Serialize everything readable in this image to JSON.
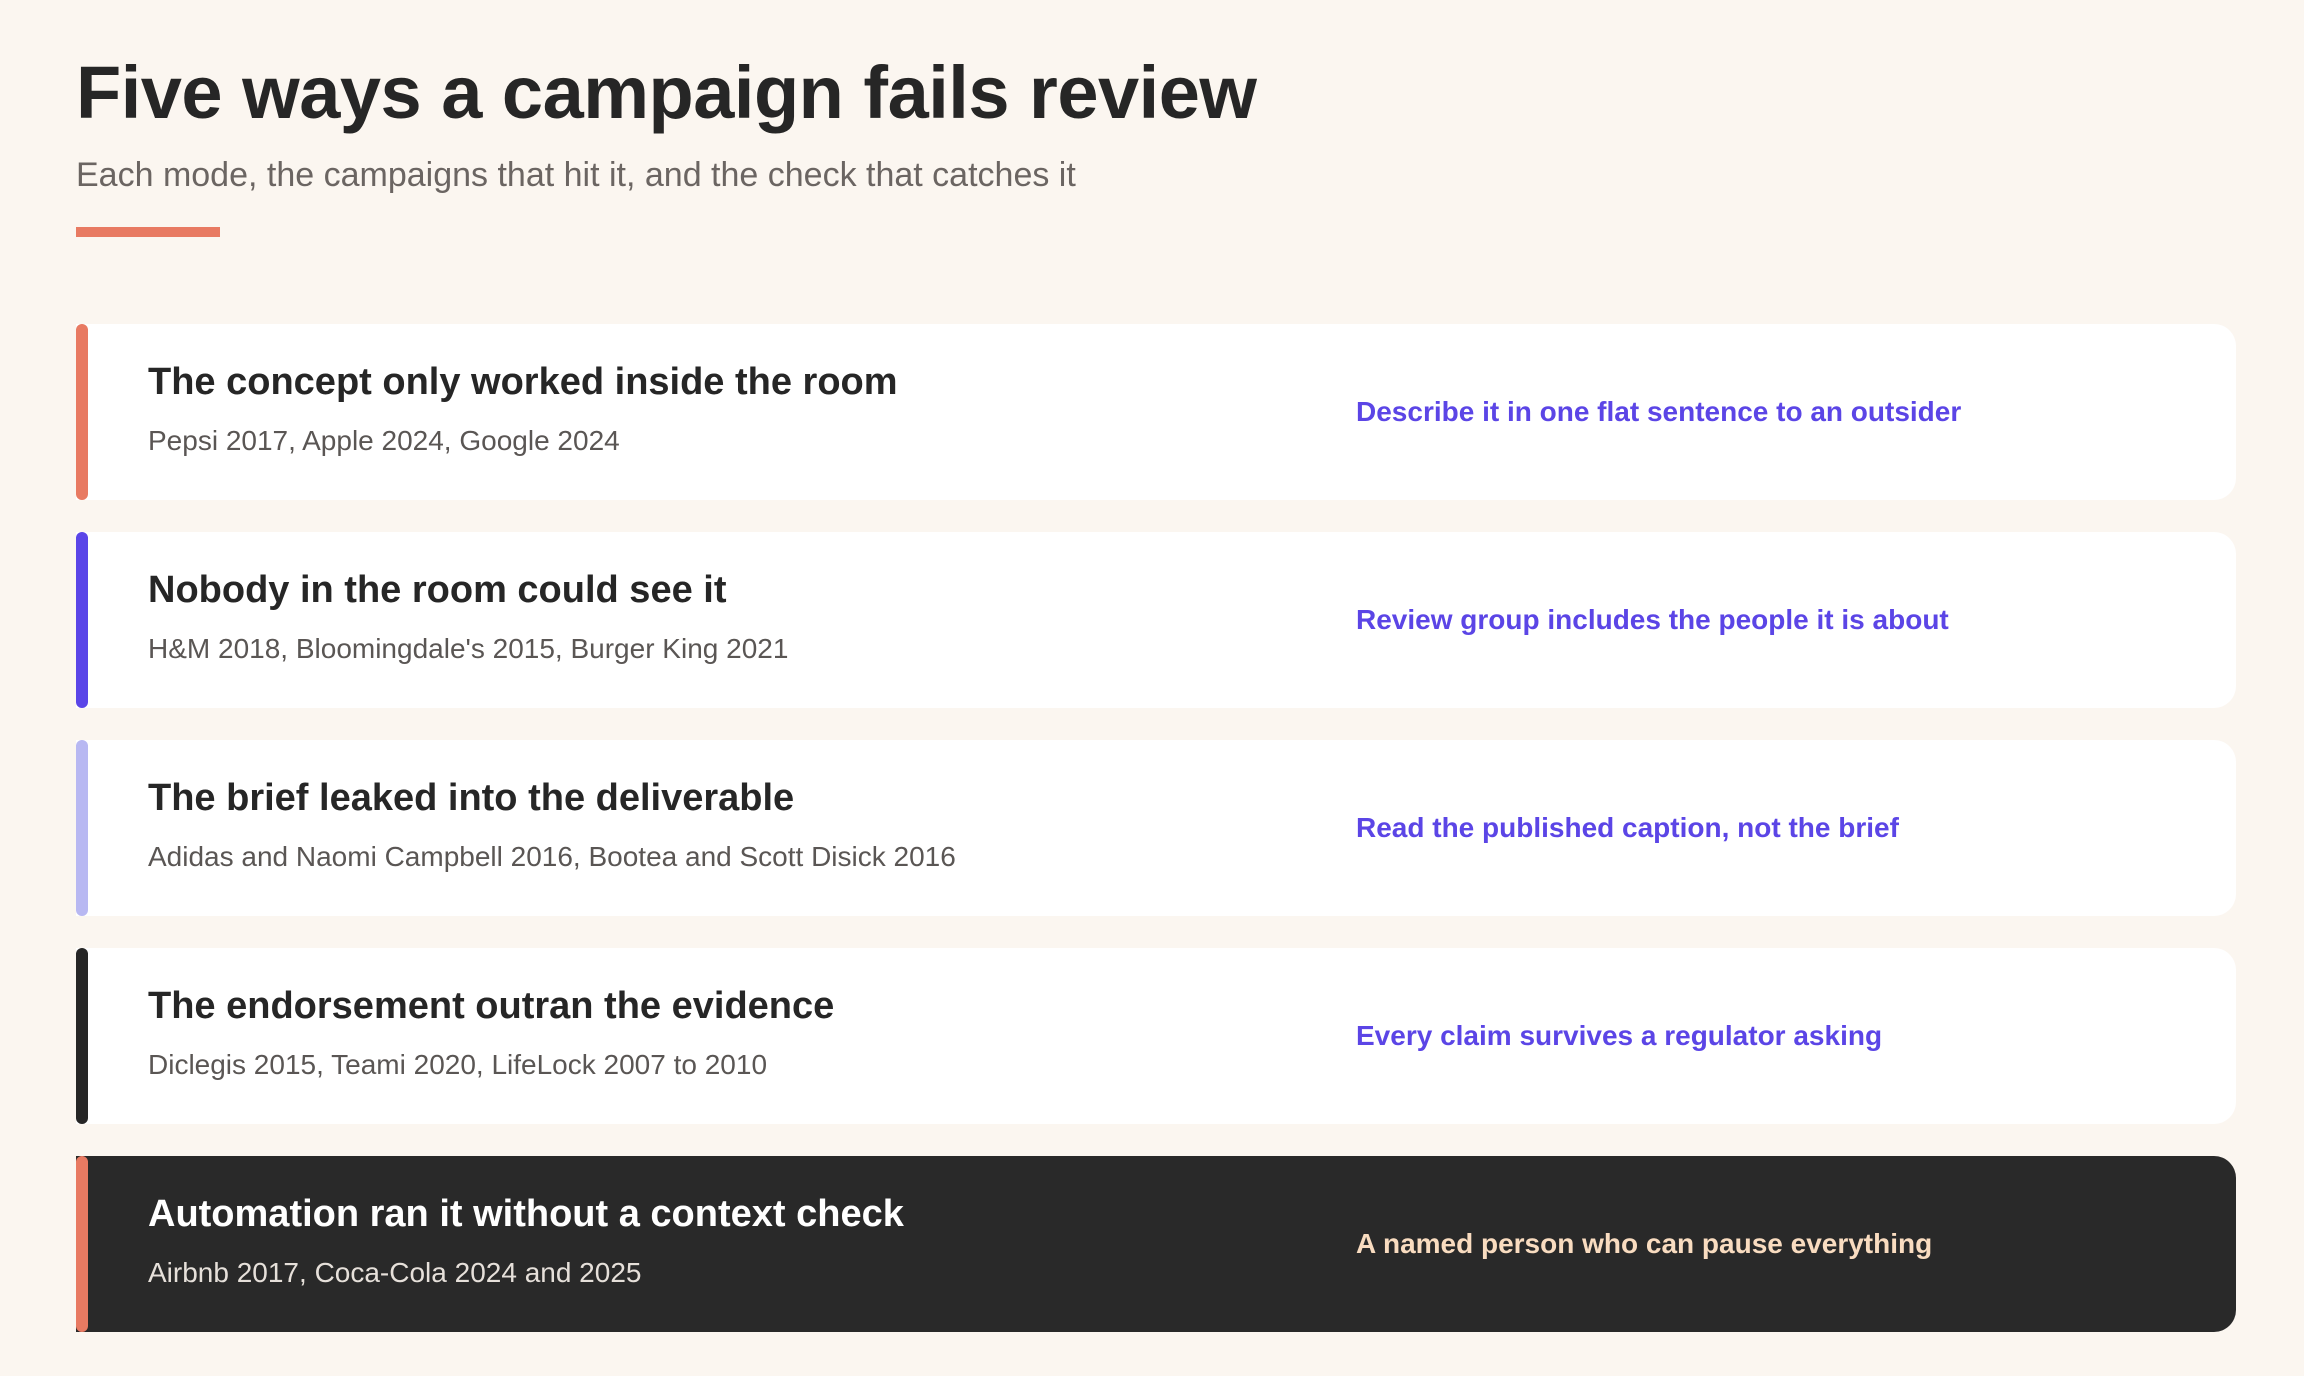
{
  "header": {
    "title": "Five ways a campaign fails review",
    "subtitle": "Each mode, the campaigns that hit it, and the check that catches it",
    "accent_color": "#e87a62"
  },
  "rows": [
    {
      "title": "The concept only worked inside the room",
      "examples": "Pepsi 2017, Apple 2024, Google 2024",
      "check": "Describe it in one flat sentence to an outsider",
      "accent_color": "#e87a62"
    },
    {
      "title": "Nobody in the room could see it",
      "examples": "H&M 2018, Bloomingdale's 2015, Burger King 2021",
      "check": "Review group includes the people it is about",
      "accent_color": "#5a45e8"
    },
    {
      "title": "The brief leaked into the deliverable",
      "examples": "Adidas and Naomi Campbell 2016, Bootea and Scott Disick 2016",
      "check": "Read the published caption, not the brief",
      "accent_color": "#b8b8f2"
    },
    {
      "title": "The endorsement outran the evidence",
      "examples": "Diclegis 2015, Teami 2020, LifeLock 2007 to 2010",
      "check": "Every claim survives a regulator asking",
      "accent_color": "#262626"
    },
    {
      "title": "Automation ran it without a context check",
      "examples": "Airbnb 2017, Coca-Cola 2024 and 2025",
      "check": "A named person who can pause everything",
      "accent_color": "#e87a62"
    }
  ]
}
